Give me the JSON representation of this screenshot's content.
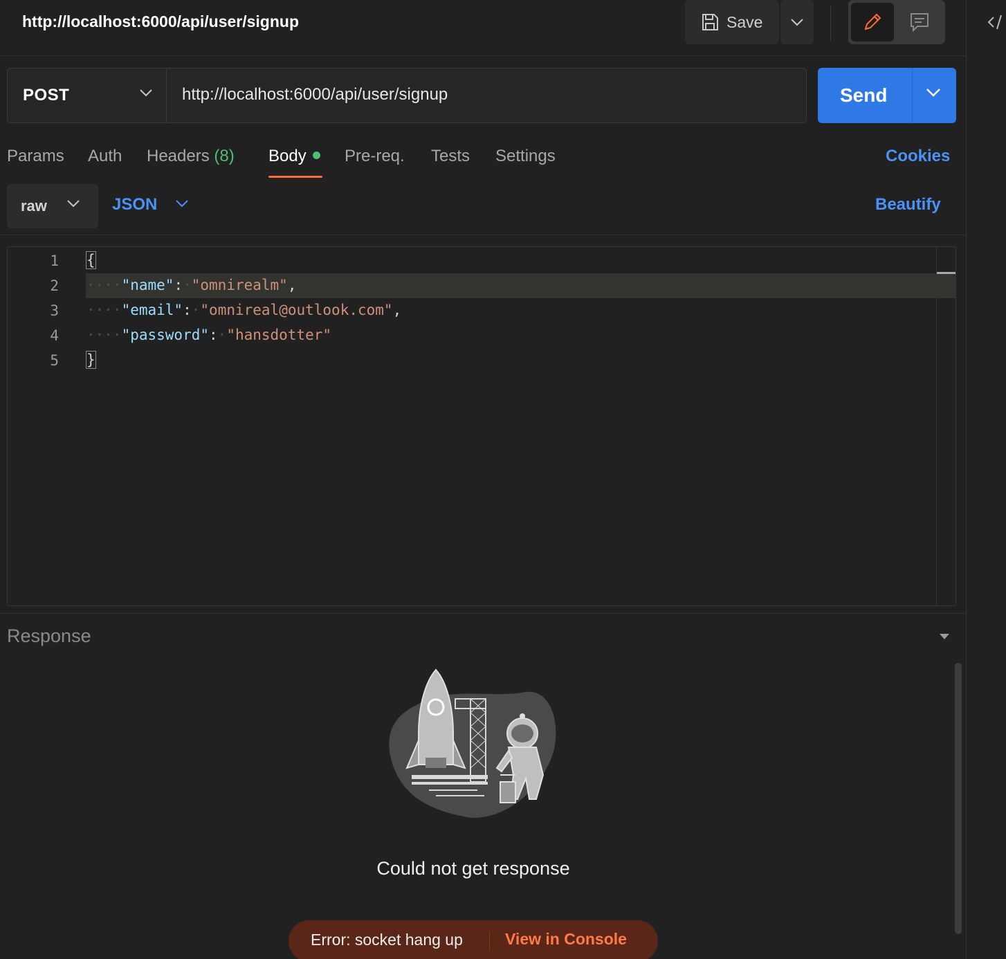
{
  "request": {
    "title": "http://localhost:6000/api/user/signup",
    "method": "POST",
    "url": "http://localhost:6000/api/user/signup"
  },
  "toolbar": {
    "save_label": "Save",
    "send_label": "Send"
  },
  "tabs": [
    {
      "label": "Params"
    },
    {
      "label": "Auth"
    },
    {
      "label": "Headers",
      "count": "(8)"
    },
    {
      "label": "Body",
      "active": true
    },
    {
      "label": "Pre-req."
    },
    {
      "label": "Tests"
    },
    {
      "label": "Settings"
    }
  ],
  "cookies_label": "Cookies",
  "body_options": {
    "mode": "raw",
    "language": "JSON",
    "beautify_label": "Beautify"
  },
  "editor": {
    "line_numbers": [
      "1",
      "2",
      "3",
      "4",
      "5"
    ],
    "lines": [
      {
        "brace": "{"
      },
      {
        "key": "\"name\"",
        "value": "\"omnirealm\"",
        "trail": ","
      },
      {
        "key": "\"email\"",
        "value": "\"omnireal@outlook.com\"",
        "trail": ","
      },
      {
        "key": "\"password\"",
        "value": "\"hansdotter\"",
        "trail": ""
      },
      {
        "brace": "}"
      }
    ]
  },
  "response": {
    "title": "Response",
    "empty_message": "Could not get response",
    "error_message": "Error: socket hang up",
    "console_link": "View in Console"
  },
  "colors": {
    "accent_blue": "#2f79e6",
    "link_blue": "#4a92f7",
    "accent_orange": "#ff6c37",
    "success_green": "#4bbf73",
    "error_bg": "#5a2617"
  },
  "icons": [
    "save-icon",
    "chevron-down-icon",
    "pencil-icon",
    "comment-icon",
    "code-icon",
    "caret-down-icon"
  ]
}
